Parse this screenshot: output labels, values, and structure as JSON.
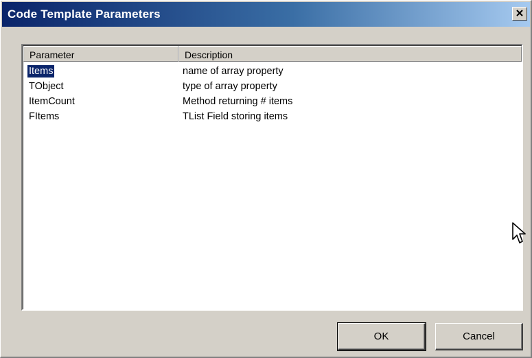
{
  "window": {
    "title": "Code Template Parameters",
    "close_symbol": "×"
  },
  "listview": {
    "columns": [
      "Parameter",
      "Description"
    ],
    "rows": [
      {
        "parameter": "Items",
        "description": "name of array property",
        "selected": true
      },
      {
        "parameter": "TObject",
        "description": "type of array property",
        "selected": false
      },
      {
        "parameter": "ItemCount",
        "description": "Method returning # items",
        "selected": false
      },
      {
        "parameter": "FItems",
        "description": "TList Field storing items",
        "selected": false
      }
    ]
  },
  "buttons": {
    "ok_label": "OK",
    "cancel_label": "Cancel"
  },
  "icons": {
    "close": "close-icon",
    "cursor": "mouse-pointer-icon"
  },
  "colors": {
    "titlebar_start": "#0a246a",
    "titlebar_end": "#a6caf0",
    "face": "#d4d0c8",
    "selection": "#0a246a"
  }
}
